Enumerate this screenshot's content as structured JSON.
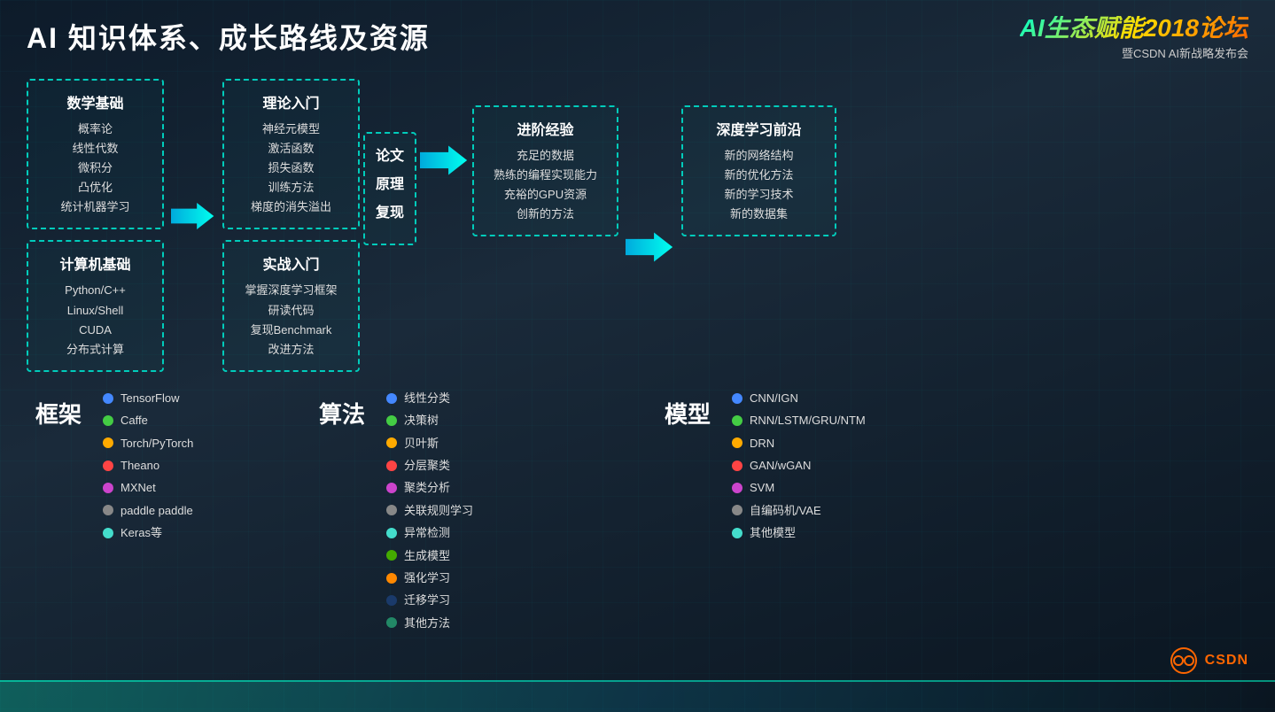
{
  "header": {
    "main_title": "AI 知识体系、成长路线及资源",
    "logo_title": "AI生态赋能2018论坛",
    "logo_subtitle": "暨CSDN AI新战略发布会"
  },
  "math_box": {
    "title": "数学基础",
    "items": [
      "概率论",
      "线性代数",
      "微积分",
      "凸优化",
      "统计机器学习"
    ]
  },
  "computer_box": {
    "title": "计算机基础",
    "items": [
      "Python/C++",
      "Linux/Shell",
      "CUDA",
      "分布式计算"
    ]
  },
  "theory_box": {
    "title": "理论入门",
    "items": [
      "神经元模型",
      "激活函数",
      "损失函数",
      "训练方法",
      "梯度的消失溢出"
    ]
  },
  "practice_box": {
    "title": "实战入门",
    "items": [
      "掌握深度学习框架",
      "研读代码",
      "复现Benchmark",
      "改进方法"
    ]
  },
  "paper_box": {
    "lines": [
      "论文",
      "原理",
      "复现"
    ]
  },
  "advanced_box": {
    "title": "进阶经验",
    "items": [
      "充足的数据",
      "熟练的编程实现能力",
      "充裕的GPU资源",
      "创新的方法"
    ]
  },
  "deep_box": {
    "title": "深度学习前沿",
    "items": [
      "新的网络结构",
      "新的优化方法",
      "新的学习技术",
      "新的数据集"
    ]
  },
  "frameworks": {
    "title": "框架",
    "items": [
      {
        "color": "#4488ff",
        "label": "TensorFlow"
      },
      {
        "color": "#44cc44",
        "label": "Caffe"
      },
      {
        "color": "#ffaa00",
        "label": "Torch/PyTorch"
      },
      {
        "color": "#ff4444",
        "label": "Theano"
      },
      {
        "color": "#cc44cc",
        "label": "MXNet"
      },
      {
        "color": "#888888",
        "label": "paddle paddle"
      },
      {
        "color": "#44ddcc",
        "label": "Keras等"
      }
    ]
  },
  "algorithms": {
    "title": "算法",
    "items": [
      {
        "color": "#4488ff",
        "label": "线性分类"
      },
      {
        "color": "#44cc44",
        "label": "决策树"
      },
      {
        "color": "#ffaa00",
        "label": "贝叶斯"
      },
      {
        "color": "#ff4444",
        "label": "分层聚类"
      },
      {
        "color": "#cc44cc",
        "label": "聚类分析"
      },
      {
        "color": "#888888",
        "label": "关联规则学习"
      },
      {
        "color": "#44ddcc",
        "label": "异常检测"
      },
      {
        "color": "#44aa00",
        "label": "生成模型"
      },
      {
        "color": "#ff8800",
        "label": "强化学习"
      },
      {
        "color": "#224488",
        "label": "迁移学习"
      },
      {
        "color": "#228866",
        "label": "其他方法"
      }
    ]
  },
  "models": {
    "title": "模型",
    "items": [
      {
        "color": "#4488ff",
        "label": "CNN/IGN"
      },
      {
        "color": "#44cc44",
        "label": "RNN/LSTM/GRU/NTM"
      },
      {
        "color": "#ffaa00",
        "label": "DRN"
      },
      {
        "color": "#ff4444",
        "label": "GAN/wGAN"
      },
      {
        "color": "#cc44cc",
        "label": "SVM"
      },
      {
        "color": "#888888",
        "label": "自编码机/VAE"
      },
      {
        "color": "#44ddcc",
        "label": "其他模型"
      }
    ]
  },
  "csdn": {
    "text": "CSDN"
  }
}
